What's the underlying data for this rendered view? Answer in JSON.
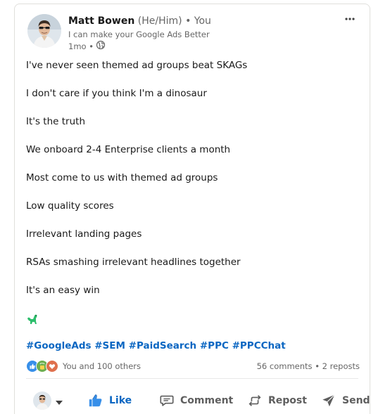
{
  "post": {
    "author": {
      "name": "Matt Bowen",
      "pronouns": "(He/Him)",
      "degree": "• You",
      "headline": "I can make your Google Ads Better",
      "time": "1mo •",
      "visibility_icon": "globe-icon"
    },
    "body_lines": [
      "I've never seen themed ad groups beat SKAGs",
      "I don't care if you think I'm a dinosaur",
      "It's the truth",
      "We onboard 2-4 Enterprise clients a month",
      "Most come to us with themed ad groups",
      "Low quality scores",
      "Irrelevant landing pages",
      "RSAs smashing irrelevant headlines together",
      "It's an easy win"
    ],
    "emoji": "dinosaur-emoji",
    "hashtags": [
      "#GoogleAds",
      "#SEM",
      "#PaidSearch",
      "#PPC",
      "#PPCChat"
    ],
    "reactions": {
      "icons": [
        "like-reaction-icon",
        "celebrate-reaction-icon",
        "love-reaction-icon"
      ],
      "text": "You and 100 others"
    },
    "social_counts": {
      "comments": "56 comments",
      "separator": "•",
      "reposts": "2 reposts"
    },
    "actions": {
      "like": "Like",
      "comment": "Comment",
      "repost": "Repost",
      "send": "Send"
    }
  },
  "colors": {
    "link_blue": "#0a66c2",
    "muted_text": "#666666",
    "body_text": "#191919",
    "action_gray": "#5e5e5e"
  }
}
